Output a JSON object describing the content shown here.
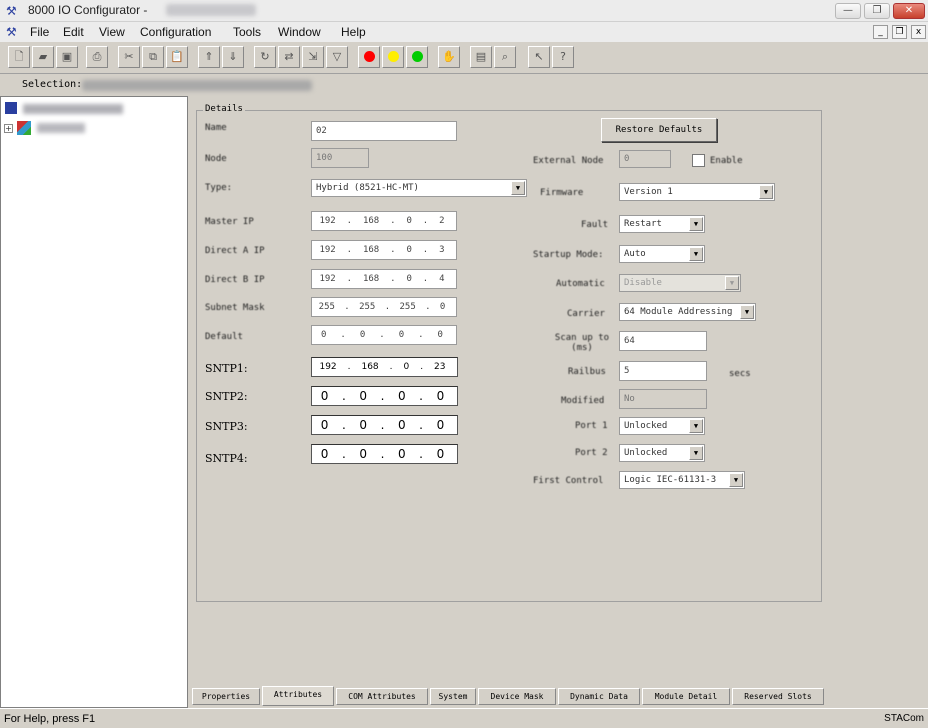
{
  "window": {
    "title": "8000 IO Configurator -",
    "min_glyph": "—",
    "max_glyph": "❐",
    "close_glyph": "✕",
    "mdi_buttons": [
      "_",
      "❐",
      "x"
    ]
  },
  "menu": {
    "items": [
      "File",
      "Edit",
      "View",
      "Configuration",
      "Tools",
      "Window",
      "Help"
    ]
  },
  "toolbar": {
    "icons": [
      "new-file-icon",
      "open-folder-icon",
      "save-icon",
      "print-icon",
      "cut-icon",
      "copy-icon",
      "paste-icon",
      "upload-icon",
      "download-icon",
      "refresh-icon",
      "compare-icon",
      "export-icon",
      "filter-icon",
      "red-status-icon",
      "yellow-status-icon",
      "green-status-icon",
      "stop-icon",
      "monitor-icon",
      "find-icon",
      "context-help-icon",
      "help-icon"
    ],
    "colors": {
      "red": "#ff0000",
      "yellow": "#ffee00",
      "green": "#00cc00"
    }
  },
  "selection": {
    "label": "Selection:"
  },
  "details": {
    "legend": "Details",
    "left": {
      "name_label": "Name",
      "name_value": "02",
      "node_label": "Node",
      "node_value": "100",
      "type_label": "Type:",
      "type_value": "Hybrid (8521-HC-MT)",
      "master_ip_label": "Master IP",
      "master_ip": [
        "192",
        "168",
        "0",
        "2"
      ],
      "direct_a_ip_label": "Direct A IP",
      "direct_a_ip": [
        "192",
        "168",
        "0",
        "3"
      ],
      "direct_b_ip_label": "Direct B IP",
      "direct_b_ip": [
        "192",
        "168",
        "0",
        "4"
      ],
      "subnet_mask_label": "Subnet Mask",
      "subnet_mask": [
        "255",
        "255",
        "255",
        "0"
      ],
      "default_label": "Default",
      "default_ip": [
        "0",
        "0",
        "0",
        "0"
      ],
      "sntp1_label": "SNTP1:",
      "sntp1": [
        "192",
        "168",
        "0",
        "23"
      ],
      "sntp2_label": "SNTP2:",
      "sntp2": [
        "0",
        "0",
        "0",
        "0"
      ],
      "sntp3_label": "SNTP3:",
      "sntp3": [
        "0",
        "0",
        "0",
        "0"
      ],
      "sntp4_label": "SNTP4:",
      "sntp4": [
        "0",
        "0",
        "0",
        "0"
      ]
    },
    "right": {
      "restore_defaults_label": "Restore Defaults",
      "external_node_label": "External Node",
      "external_node_value": "0",
      "enable_label": "Enable",
      "firmware_label": "Firmware",
      "firmware_value": "Version 1",
      "fault_label": "Fault",
      "fault_value": "Restart",
      "startup_mode_label": "Startup Mode:",
      "startup_mode_value": "Auto",
      "automatic_label": "Automatic",
      "automatic_value": "Disable",
      "carrier_label": "Carrier",
      "carrier_value": "64 Module Addressing",
      "scan_up_to_label": "Scan up to (ms)",
      "scan_up_to_value": "64",
      "railbus_label": "Railbus",
      "railbus_value": "5",
      "railbus_unit": "secs",
      "modified_label": "Modified",
      "modified_value": "No",
      "port1_label": "Port 1",
      "port1_value": "Unlocked",
      "port2_label": "Port 2",
      "port2_value": "Unlocked",
      "first_control_label": "First Control",
      "first_control_value": "Logic IEC-61131-3"
    }
  },
  "tabs": [
    "Properties",
    "Attributes",
    "COM Attributes",
    "System",
    "Device Mask",
    "Dynamic Data",
    "Module Detail",
    "Reserved Slots"
  ],
  "active_tab": "Attributes",
  "status": {
    "text": "For Help, press F1",
    "right": "STACom"
  }
}
